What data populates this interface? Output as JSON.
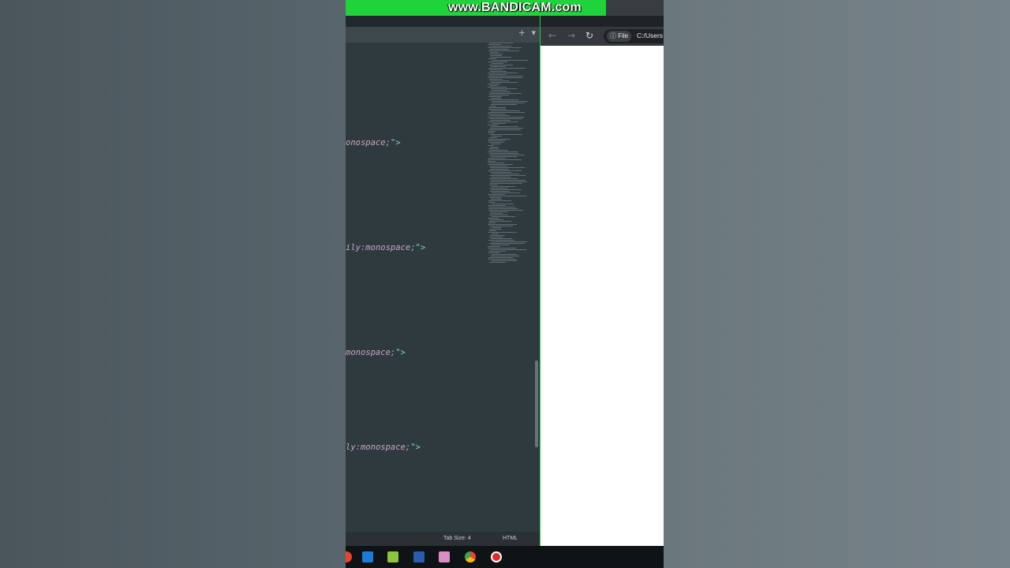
{
  "watermark": {
    "text": "www.BANDICAM.com"
  },
  "editor": {
    "tab_controls": {
      "add": "+",
      "menu": "▾"
    },
    "code_lines": [
      {
        "attr": "onospace",
        "punc": ";",
        "str": "\">"
      },
      {
        "attr": "ily",
        "punc": ":",
        "val": "monospace",
        "punc2": ";",
        "str": "\">"
      },
      {
        "attr": "monospace",
        "punc": ";",
        "str": "\">"
      },
      {
        "attr": "ly",
        "punc": ":",
        "val": "monospace",
        "punc2": ";",
        "str": "\">"
      }
    ],
    "status": {
      "tab_size": "Tab Size: 4",
      "language": "HTML"
    }
  },
  "browser": {
    "nav": {
      "back": "←",
      "forward": "→",
      "reload": "↻"
    },
    "site_info": "ⓘ File",
    "url": "C:/Users"
  },
  "taskbar": {
    "icons": [
      "chrome-icon",
      "app-icon",
      "notepad-icon",
      "word-icon",
      "paint-icon",
      "chrome-icon",
      "record-icon"
    ]
  }
}
